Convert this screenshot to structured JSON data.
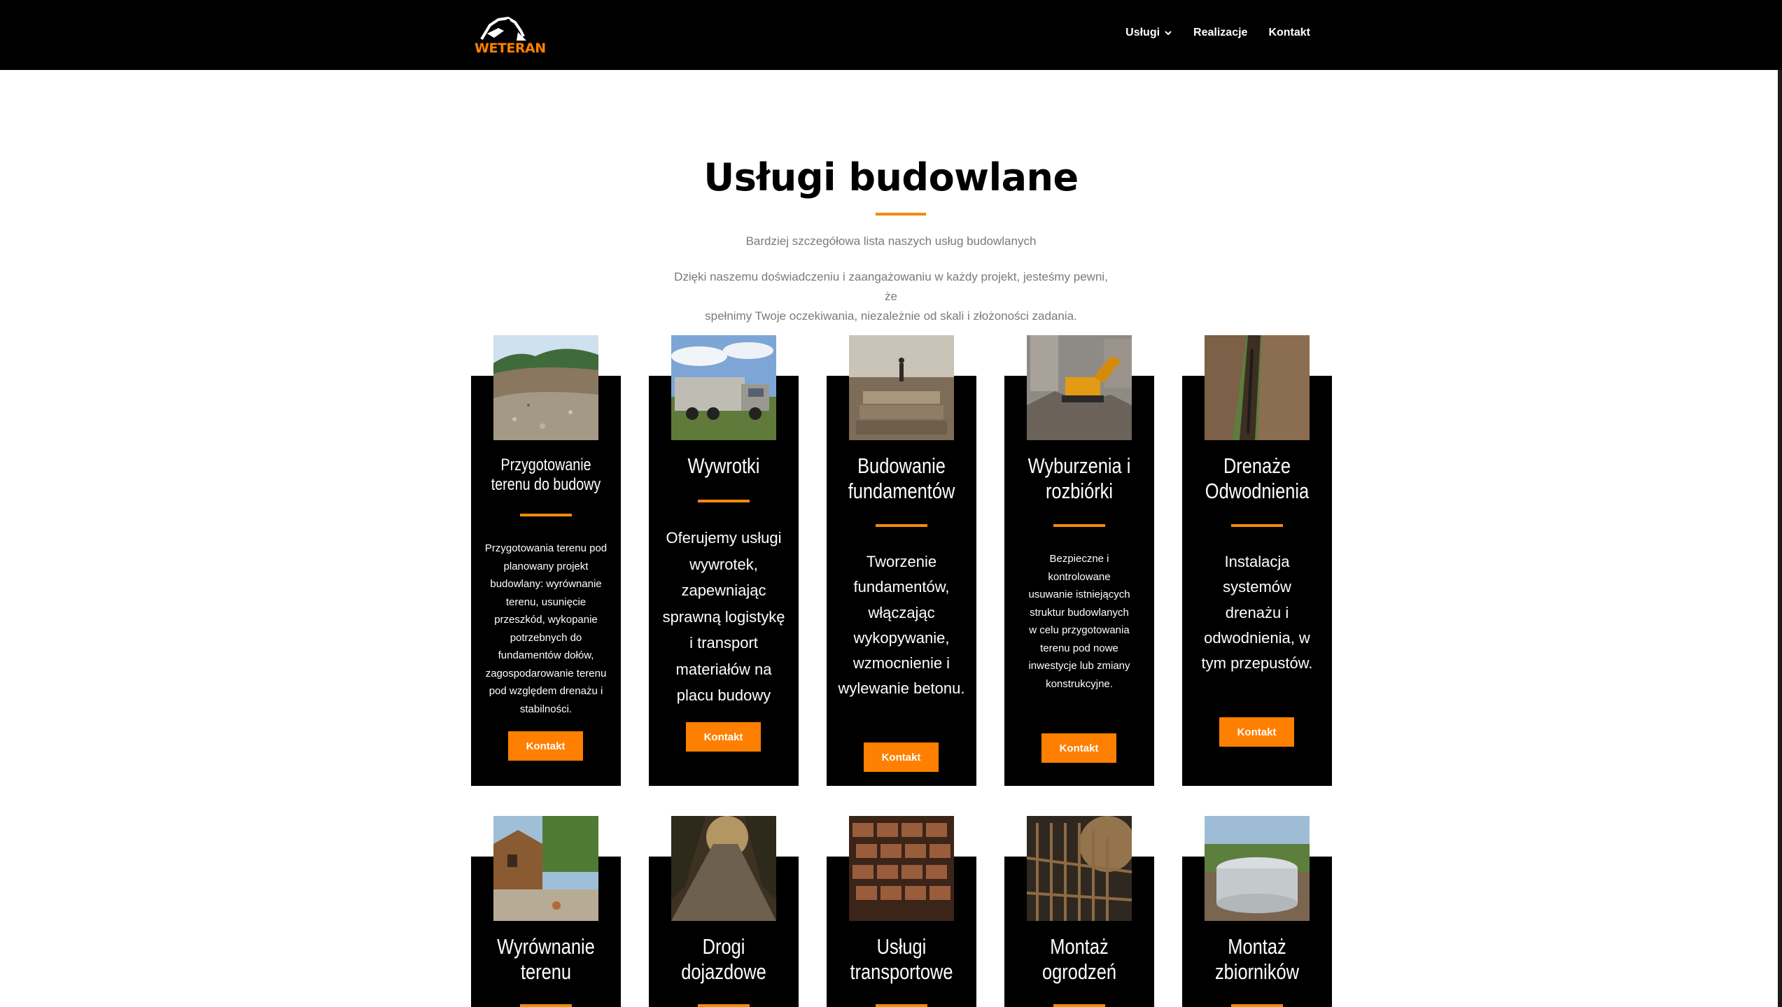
{
  "header": {
    "logo_text": "WETERAN",
    "nav": [
      {
        "label": "Usługi",
        "has_dropdown": true
      },
      {
        "label": "Realizacje"
      },
      {
        "label": "Kontakt"
      }
    ]
  },
  "intro": {
    "title": "Usługi budowlane",
    "subtitle": "Bardziej szczegółowa lista naszych usług budowlanych",
    "text_line1": "Dzięki naszemu doświadczeniu i zaangażowaniu w każdy projekt, jesteśmy pewni, że",
    "text_line2": "spełnimy Twoje oczekiwania, niezależnie od skali i złożoności zadania."
  },
  "colors": {
    "accent": "#f28a0e",
    "button": "#ff7f00",
    "card_bg": "#000000",
    "muted_text": "#7a7a7a"
  },
  "cards_row1": [
    {
      "image": "terrain-preparation-photo",
      "title_lines": [
        "Przygotowanie",
        "terenu do budowy"
      ],
      "description_lines": [
        "Przygotowania terenu pod",
        "planowany projekt",
        "budowlany: wyrównanie",
        "terenu, usunięcie",
        "przeszkód, wykopanie",
        "potrzebnych do",
        "fundamentów dołów,",
        "zagospodarowanie terenu",
        "pod względem drenażu i",
        "stabilności."
      ],
      "button": "Kontakt"
    },
    {
      "image": "dump-truck-photo",
      "title_lines": [
        "Wywrotki"
      ],
      "description_lines": [
        "Oferujemy usługi",
        "wywrotek,",
        "zapewniając",
        "sprawną logistykę",
        "i transport",
        "materiałów na",
        "placu budowy"
      ],
      "button": "Kontakt"
    },
    {
      "image": "foundation-photo",
      "title_lines": [
        "Budowanie",
        "fundamentów"
      ],
      "description_lines": [
        "Tworzenie",
        "fundamentów,",
        "włączając",
        "wykopywanie,",
        "wzmocnienie i",
        "wylewanie betonu."
      ],
      "button": "Kontakt"
    },
    {
      "image": "demolition-excavator-photo",
      "title_lines": [
        "Wyburzenia i",
        "rozbiórki"
      ],
      "description_lines": [
        "Bezpieczne i",
        "kontrolowane",
        "usuwanie istniejących",
        "struktur budowlanych",
        "w celu przygotowania",
        "terenu pod nowe",
        "inwestycje lub zmiany",
        "konstrukcyjne."
      ],
      "button": "Kontakt"
    },
    {
      "image": "drainage-trench-photo",
      "title_lines": [
        "Drenaże",
        "Odwodnienia"
      ],
      "description_lines": [
        "Instalacja",
        "systemów",
        "drenażu i",
        "odwodnienia, w",
        "tym przepustów."
      ],
      "button": "Kontakt"
    }
  ],
  "cards_row2": [
    {
      "image": "leveling-terrain-photo",
      "title_lines": [
        "Wyrównanie",
        "terenu"
      ]
    },
    {
      "image": "access-road-photo",
      "title_lines": [
        "Drogi",
        "dojazdowe"
      ]
    },
    {
      "image": "transport-materials-photo",
      "title_lines": [
        "Usługi",
        "transportowe"
      ]
    },
    {
      "image": "fence-photo",
      "title_lines": [
        "Montaż",
        "ogrodzeń"
      ]
    },
    {
      "image": "tank-photo",
      "title_lines": [
        "Montaż",
        "zbiorników"
      ]
    }
  ]
}
